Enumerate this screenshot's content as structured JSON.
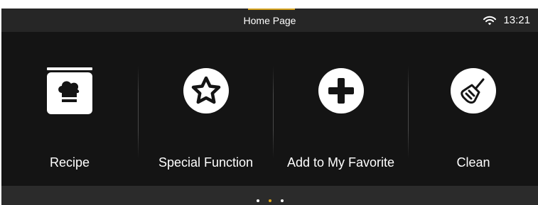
{
  "status_bar": {
    "title": "Home Page",
    "time": "13:21",
    "wifi_icon": "wifi-icon",
    "accent_color": "#d4a11e"
  },
  "menu": {
    "items": [
      {
        "label": "Recipe",
        "icon": "recipe-book-icon"
      },
      {
        "label": "Special Function",
        "icon": "star-icon"
      },
      {
        "label": "Add to My Favorite",
        "icon": "plus-icon"
      },
      {
        "label": "Clean",
        "icon": "clean-brush-icon"
      }
    ]
  },
  "pager": {
    "pages": 3,
    "current_page": 2,
    "active_color": "#e0a81d"
  }
}
